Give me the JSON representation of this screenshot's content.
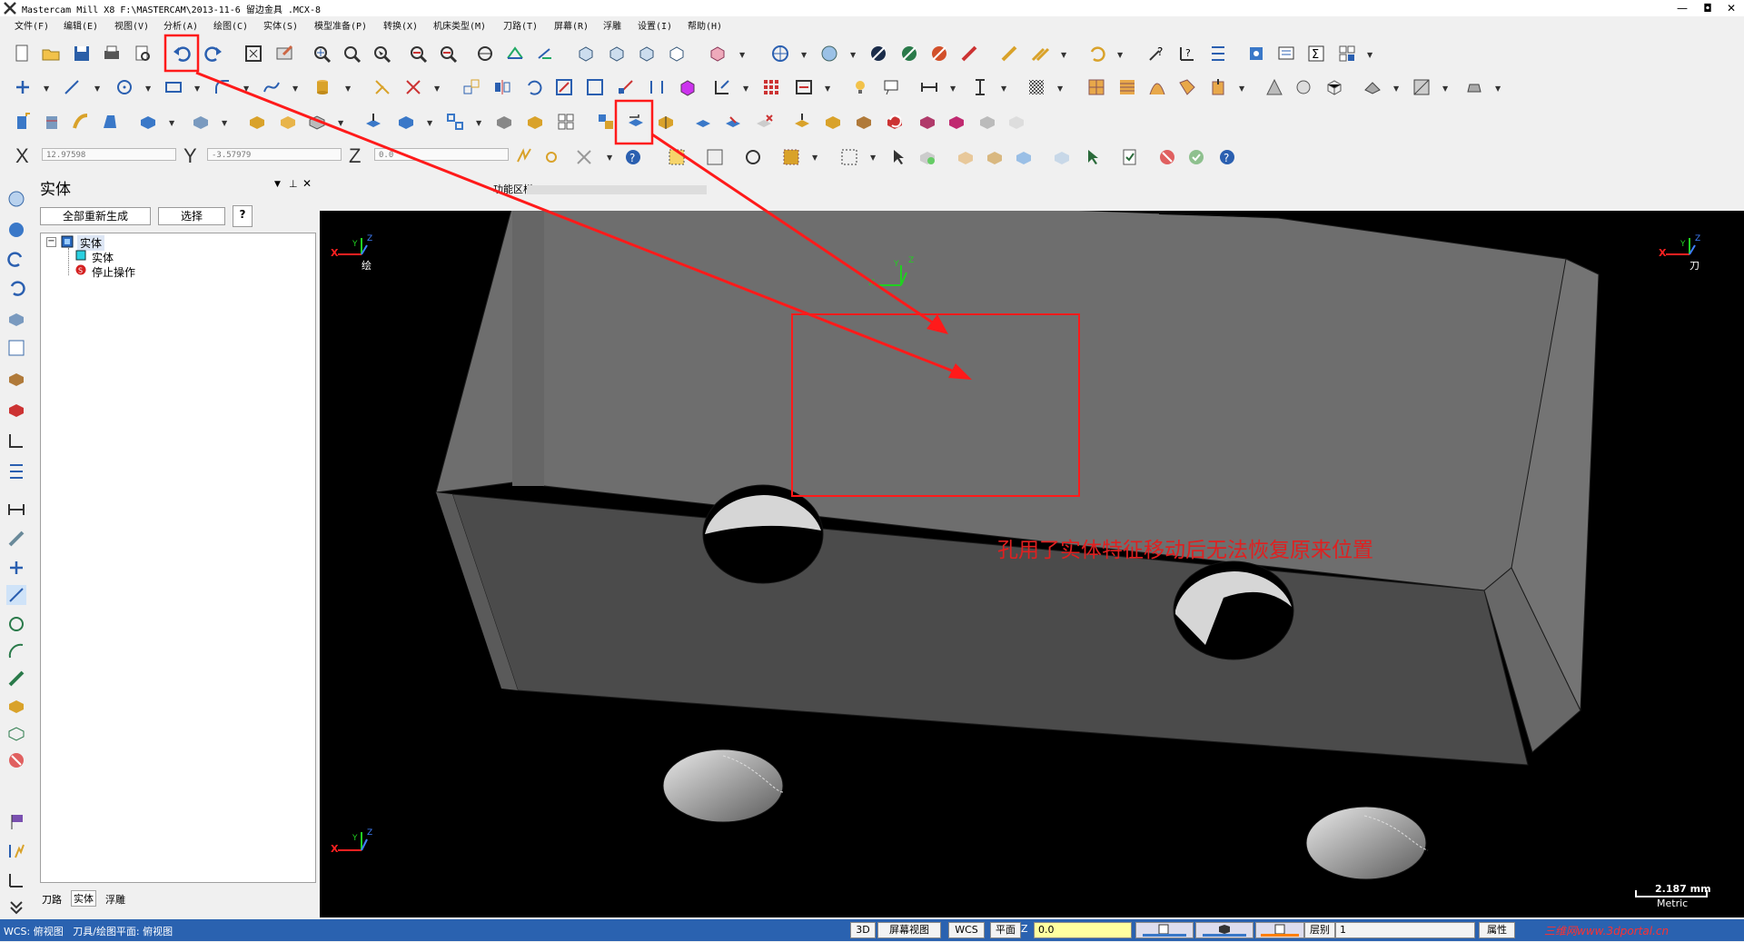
{
  "window": {
    "title": "Mastercam Mill X8  F:\\MASTERCAM\\2013-11-6 留边金具  .MCX-8",
    "minimize": "—",
    "maximize": "◘",
    "close": "✕"
  },
  "menu": [
    "文件(F)",
    "编辑(E)",
    "视图(V)",
    "分析(A)",
    "绘图(C)",
    "实体(S)",
    "模型准备(P)",
    "转换(X)",
    "机床类型(M)",
    "刀路(T)",
    "屏幕(R)",
    "浮雕",
    "设置(I)",
    "帮助(H)"
  ],
  "coords": {
    "x_label": "X",
    "x_value": "12.97598",
    "y_label": "Y",
    "y_value": "-3.57979",
    "z_label": "Z",
    "z_value": "0.0"
  },
  "function_area_label": "功能区栏",
  "panel": {
    "title": "实体",
    "regen_all": "全部重新生成",
    "select": "选择",
    "help": "?",
    "tree": {
      "root": "实体",
      "child_solid": "实体",
      "child_stop": "停止操作"
    },
    "tabs": [
      "刀路",
      "实体",
      "浮雕"
    ],
    "active_tab_index": 1
  },
  "viewport": {
    "annotation": "孔用了实体特征移动后无法恢复原来位置",
    "axis_left_top": {
      "x": "X",
      "y": "Y",
      "z": "Z",
      "label": "绘"
    },
    "axis_right_top": {
      "x": "X",
      "y": "Y",
      "z": "Z",
      "label": "刀"
    },
    "axis_center": {
      "x": "X",
      "y": "Y",
      "z": "Z"
    },
    "axis_left_bottom": {
      "x": "X",
      "y": "Y",
      "z": "Z"
    },
    "scale_value": "2.187 mm",
    "scale_unit": "Metric",
    "background_color": "#000000",
    "part_color": "#6e6e6e",
    "highlight_color": "#ff1a1a"
  },
  "status": {
    "left_text": "WCS: 俯视图   刀具/绘图平面: 俯视图",
    "mode_3d": "3D",
    "screen_view": "屏幕视图",
    "wcs": "WCS",
    "plane": "平面",
    "z_label": "Z",
    "z_value": "0.0",
    "level_label": "层别",
    "level_value": "1",
    "attributes": "属性",
    "watermark": "三维网www.3dportal.cn"
  }
}
